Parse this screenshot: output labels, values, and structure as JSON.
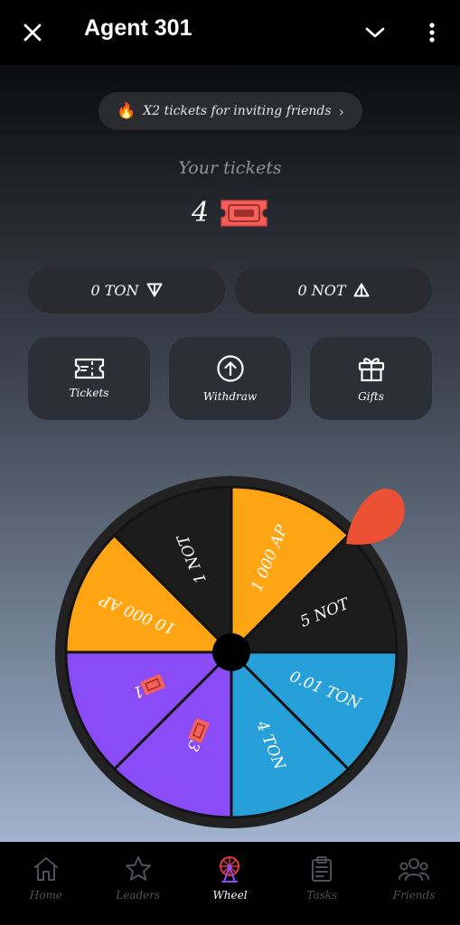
{
  "header": {
    "title": "Agent 301"
  },
  "promo": {
    "emoji": "🔥",
    "text": "X2 tickets for inviting friends",
    "chevron": "›"
  },
  "tickets": {
    "label": "Your tickets",
    "count": "4"
  },
  "balances": {
    "ton": "0 TON",
    "not": "0 NOT"
  },
  "actions": {
    "tickets": "Tickets",
    "withdraw": "Withdraw",
    "gifts": "Gifts"
  },
  "wheel": {
    "segments": [
      {
        "label": "1 000 AP",
        "color": "#ffa412"
      },
      {
        "label": "5 NOT",
        "color": "#1c1c1c"
      },
      {
        "label": "0.01 TON",
        "color": "#27a0da"
      },
      {
        "label": "4 TON",
        "color": "#27a0da"
      },
      {
        "label": "3",
        "color": "#8a4cf6"
      },
      {
        "label": "1",
        "color": "#8a4cf6"
      },
      {
        "label": "10 000 AP",
        "color": "#ffa412"
      },
      {
        "label": "1 NOT",
        "color": "#1c1c1c"
      }
    ],
    "pointer_color": "#ec5035"
  },
  "nav": {
    "items": [
      {
        "label": "Home",
        "icon": "home-icon"
      },
      {
        "label": "Leaders",
        "icon": "star-icon"
      },
      {
        "label": "Wheel",
        "icon": "ferris-wheel-icon",
        "active": true
      },
      {
        "label": "Tasks",
        "icon": "clipboard-icon"
      },
      {
        "label": "Friends",
        "icon": "people-icon"
      }
    ]
  },
  "colors": {
    "accent_ticket": "#ff5a5a",
    "ap_orange": "#ffa412",
    "ton_blue": "#27a0da",
    "purple": "#8a4cf6"
  }
}
